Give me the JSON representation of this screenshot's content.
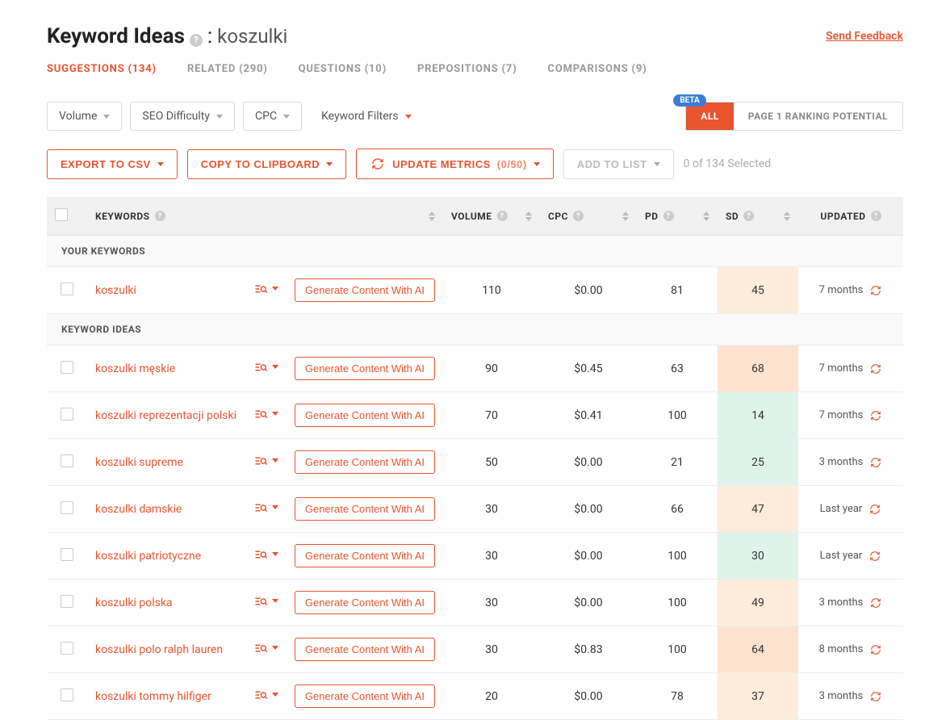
{
  "header": {
    "title": "Keyword Ideas",
    "keyword": "koszulki",
    "feedback": "Send Feedback"
  },
  "tabs": [
    {
      "label": "SUGGESTIONS",
      "count": "(134)",
      "active": true
    },
    {
      "label": "RELATED",
      "count": "(290)",
      "active": false
    },
    {
      "label": "QUESTIONS",
      "count": "(10)",
      "active": false
    },
    {
      "label": "PREPOSITIONS",
      "count": "(7)",
      "active": false
    },
    {
      "label": "COMPARISONS",
      "count": "(9)",
      "active": false
    }
  ],
  "filters": {
    "volume": "Volume",
    "seo_difficulty": "SEO Difficulty",
    "cpc": "CPC",
    "keyword_filters": "Keyword Filters",
    "beta": "BETA",
    "all": "ALL",
    "page1": "PAGE 1 RANKING POTENTIAL"
  },
  "actions": {
    "export": "EXPORT TO CSV",
    "copy": "COPY TO CLIPBOARD",
    "update": "UPDATE METRICS",
    "update_count": "(0/50)",
    "add_list": "ADD TO LIST",
    "selected": "0 of 134 Selected"
  },
  "columns": {
    "keywords": "KEYWORDS",
    "volume": "VOLUME",
    "cpc": "CPC",
    "pd": "PD",
    "sd": "SD",
    "updated": "UPDATED"
  },
  "sections": {
    "your": "YOUR KEYWORDS",
    "ideas": "KEYWORD IDEAS"
  },
  "gen_btn": "Generate Content With AI",
  "your_keywords": [
    {
      "keyword": "koszulki",
      "volume": "110",
      "cpc": "$0.00",
      "pd": "81",
      "sd": "45",
      "sd_class": "sd-mid",
      "updated": "7 months"
    }
  ],
  "keyword_ideas": [
    {
      "keyword": "koszulki męskie",
      "volume": "90",
      "cpc": "$0.45",
      "pd": "63",
      "sd": "68",
      "sd_class": "sd-high",
      "updated": "7 months"
    },
    {
      "keyword": "koszulki reprezentacji polski",
      "volume": "70",
      "cpc": "$0.41",
      "pd": "100",
      "sd": "14",
      "sd_class": "sd-low",
      "updated": "7 months"
    },
    {
      "keyword": "koszulki supreme",
      "volume": "50",
      "cpc": "$0.00",
      "pd": "21",
      "sd": "25",
      "sd_class": "sd-low",
      "updated": "3 months"
    },
    {
      "keyword": "koszulki damskie",
      "volume": "30",
      "cpc": "$0.00",
      "pd": "66",
      "sd": "47",
      "sd_class": "sd-mid",
      "updated": "Last year"
    },
    {
      "keyword": "koszulki patriotyczne",
      "volume": "30",
      "cpc": "$0.00",
      "pd": "100",
      "sd": "30",
      "sd_class": "sd-low",
      "updated": "Last year"
    },
    {
      "keyword": "koszulki polska",
      "volume": "30",
      "cpc": "$0.00",
      "pd": "100",
      "sd": "49",
      "sd_class": "sd-mid",
      "updated": "3 months"
    },
    {
      "keyword": "koszulki polo ralph lauren",
      "volume": "30",
      "cpc": "$0.83",
      "pd": "100",
      "sd": "64",
      "sd_class": "sd-high",
      "updated": "8 months"
    },
    {
      "keyword": "koszulki tommy hilfiger",
      "volume": "20",
      "cpc": "$0.00",
      "pd": "78",
      "sd": "37",
      "sd_class": "sd-mid",
      "updated": "3 months"
    }
  ]
}
